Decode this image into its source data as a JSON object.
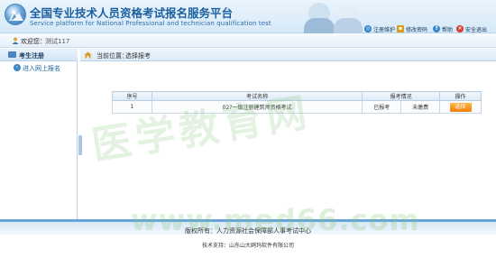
{
  "header": {
    "title_cn": "全国专业技术人员资格考试报名服务平台",
    "title_en": "Service platform for National Professional and technician qualification test",
    "links": [
      {
        "label": "注册维护",
        "icon": "registration-icon"
      },
      {
        "label": "修改密码",
        "icon": "lock-icon"
      },
      {
        "label": "帮助",
        "icon": "help-icon"
      },
      {
        "label": "安全退出",
        "icon": "exit-icon"
      }
    ]
  },
  "welcome": {
    "label": "欢迎您：",
    "name": "测试117"
  },
  "sidebar": {
    "header": "考生注册",
    "items": [
      {
        "label": "进入网上报名"
      }
    ]
  },
  "breadcrumb": {
    "label": "当前位置：",
    "value": "选择报考"
  },
  "table": {
    "headers": {
      "index": "序号",
      "name": "考试名称",
      "status": "报考情况",
      "action": "操作"
    },
    "rows": [
      {
        "index": "1",
        "name": "02?一级注册建筑师资格考试",
        "status": "已报考",
        "fee": "未缴费",
        "action": "选择"
      }
    ]
  },
  "footer": {
    "copyright": "版权所有：人力资源社会保障部人事考试中心",
    "tech": "技术支持：山东山大鸥玛软件有限公司"
  },
  "watermark": {
    "cn": "医学教育网",
    "en": "www.med66.com"
  },
  "colors": {
    "brand_blue": "#1c5f9e",
    "button_orange": "#f07f07",
    "footer_border": "#6ba4d8",
    "watermark_green": "#7ec476"
  }
}
